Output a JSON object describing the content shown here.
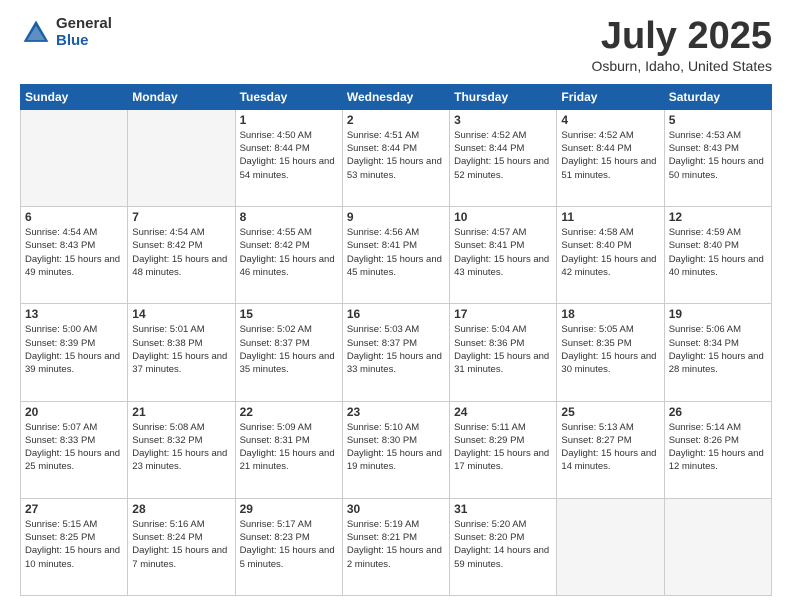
{
  "header": {
    "logo_general": "General",
    "logo_blue": "Blue",
    "month_title": "July 2025",
    "location": "Osburn, Idaho, United States"
  },
  "weekdays": [
    "Sunday",
    "Monday",
    "Tuesday",
    "Wednesday",
    "Thursday",
    "Friday",
    "Saturday"
  ],
  "weeks": [
    [
      {
        "day": "",
        "empty": true
      },
      {
        "day": "",
        "empty": true
      },
      {
        "day": "1",
        "sunrise": "4:50 AM",
        "sunset": "8:44 PM",
        "daylight": "15 hours and 54 minutes."
      },
      {
        "day": "2",
        "sunrise": "4:51 AM",
        "sunset": "8:44 PM",
        "daylight": "15 hours and 53 minutes."
      },
      {
        "day": "3",
        "sunrise": "4:52 AM",
        "sunset": "8:44 PM",
        "daylight": "15 hours and 52 minutes."
      },
      {
        "day": "4",
        "sunrise": "4:52 AM",
        "sunset": "8:44 PM",
        "daylight": "15 hours and 51 minutes."
      },
      {
        "day": "5",
        "sunrise": "4:53 AM",
        "sunset": "8:43 PM",
        "daylight": "15 hours and 50 minutes."
      }
    ],
    [
      {
        "day": "6",
        "sunrise": "4:54 AM",
        "sunset": "8:43 PM",
        "daylight": "15 hours and 49 minutes."
      },
      {
        "day": "7",
        "sunrise": "4:54 AM",
        "sunset": "8:42 PM",
        "daylight": "15 hours and 48 minutes."
      },
      {
        "day": "8",
        "sunrise": "4:55 AM",
        "sunset": "8:42 PM",
        "daylight": "15 hours and 46 minutes."
      },
      {
        "day": "9",
        "sunrise": "4:56 AM",
        "sunset": "8:41 PM",
        "daylight": "15 hours and 45 minutes."
      },
      {
        "day": "10",
        "sunrise": "4:57 AM",
        "sunset": "8:41 PM",
        "daylight": "15 hours and 43 minutes."
      },
      {
        "day": "11",
        "sunrise": "4:58 AM",
        "sunset": "8:40 PM",
        "daylight": "15 hours and 42 minutes."
      },
      {
        "day": "12",
        "sunrise": "4:59 AM",
        "sunset": "8:40 PM",
        "daylight": "15 hours and 40 minutes."
      }
    ],
    [
      {
        "day": "13",
        "sunrise": "5:00 AM",
        "sunset": "8:39 PM",
        "daylight": "15 hours and 39 minutes."
      },
      {
        "day": "14",
        "sunrise": "5:01 AM",
        "sunset": "8:38 PM",
        "daylight": "15 hours and 37 minutes."
      },
      {
        "day": "15",
        "sunrise": "5:02 AM",
        "sunset": "8:37 PM",
        "daylight": "15 hours and 35 minutes."
      },
      {
        "day": "16",
        "sunrise": "5:03 AM",
        "sunset": "8:37 PM",
        "daylight": "15 hours and 33 minutes."
      },
      {
        "day": "17",
        "sunrise": "5:04 AM",
        "sunset": "8:36 PM",
        "daylight": "15 hours and 31 minutes."
      },
      {
        "day": "18",
        "sunrise": "5:05 AM",
        "sunset": "8:35 PM",
        "daylight": "15 hours and 30 minutes."
      },
      {
        "day": "19",
        "sunrise": "5:06 AM",
        "sunset": "8:34 PM",
        "daylight": "15 hours and 28 minutes."
      }
    ],
    [
      {
        "day": "20",
        "sunrise": "5:07 AM",
        "sunset": "8:33 PM",
        "daylight": "15 hours and 25 minutes."
      },
      {
        "day": "21",
        "sunrise": "5:08 AM",
        "sunset": "8:32 PM",
        "daylight": "15 hours and 23 minutes."
      },
      {
        "day": "22",
        "sunrise": "5:09 AM",
        "sunset": "8:31 PM",
        "daylight": "15 hours and 21 minutes."
      },
      {
        "day": "23",
        "sunrise": "5:10 AM",
        "sunset": "8:30 PM",
        "daylight": "15 hours and 19 minutes."
      },
      {
        "day": "24",
        "sunrise": "5:11 AM",
        "sunset": "8:29 PM",
        "daylight": "15 hours and 17 minutes."
      },
      {
        "day": "25",
        "sunrise": "5:13 AM",
        "sunset": "8:27 PM",
        "daylight": "15 hours and 14 minutes."
      },
      {
        "day": "26",
        "sunrise": "5:14 AM",
        "sunset": "8:26 PM",
        "daylight": "15 hours and 12 minutes."
      }
    ],
    [
      {
        "day": "27",
        "sunrise": "5:15 AM",
        "sunset": "8:25 PM",
        "daylight": "15 hours and 10 minutes."
      },
      {
        "day": "28",
        "sunrise": "5:16 AM",
        "sunset": "8:24 PM",
        "daylight": "15 hours and 7 minutes."
      },
      {
        "day": "29",
        "sunrise": "5:17 AM",
        "sunset": "8:23 PM",
        "daylight": "15 hours and 5 minutes."
      },
      {
        "day": "30",
        "sunrise": "5:19 AM",
        "sunset": "8:21 PM",
        "daylight": "15 hours and 2 minutes."
      },
      {
        "day": "31",
        "sunrise": "5:20 AM",
        "sunset": "8:20 PM",
        "daylight": "14 hours and 59 minutes."
      },
      {
        "day": "",
        "empty": true
      },
      {
        "day": "",
        "empty": true
      }
    ]
  ]
}
